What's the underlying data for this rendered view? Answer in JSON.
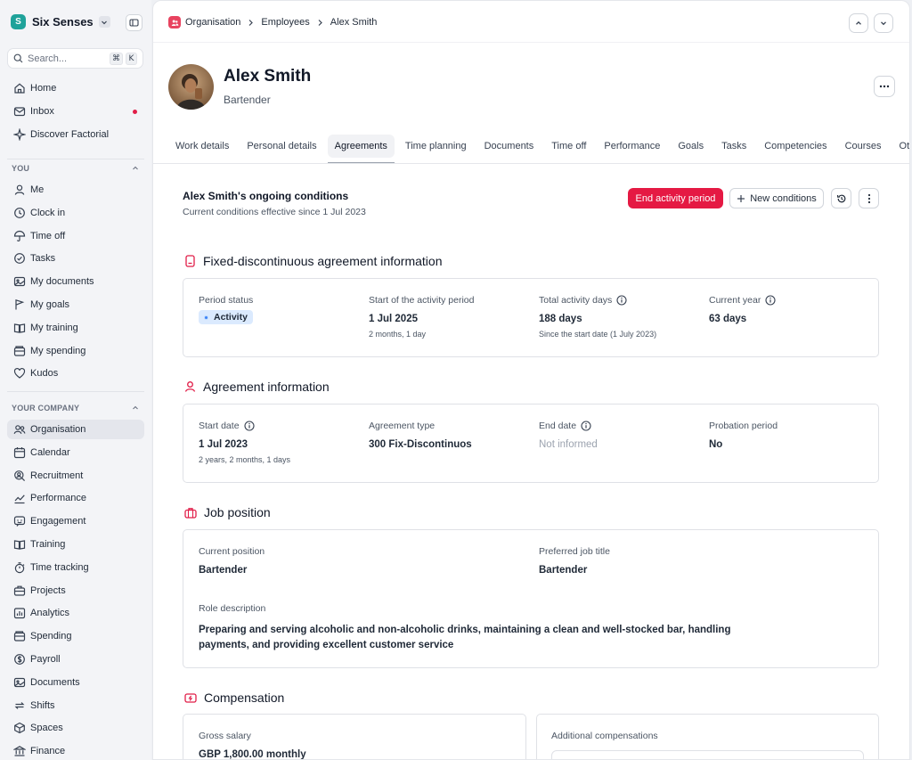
{
  "sidebar": {
    "company": "Six Senses",
    "company_initial": "S",
    "search_placeholder": "Search...",
    "shortcut_keys": [
      "⌘",
      "K"
    ],
    "top_items": [
      {
        "label": "Home",
        "icon": "home-icon"
      },
      {
        "label": "Inbox",
        "icon": "inbox-icon"
      },
      {
        "label": "Discover Factorial",
        "icon": "sparkle-icon"
      }
    ],
    "you_title": "YOU",
    "you_items": [
      {
        "label": "Me",
        "icon": "person-icon"
      },
      {
        "label": "Clock in",
        "icon": "clock-icon"
      },
      {
        "label": "Time off",
        "icon": "umbrella-icon"
      },
      {
        "label": "Tasks",
        "icon": "check-circle-icon"
      },
      {
        "label": "My documents",
        "icon": "folder-icon"
      },
      {
        "label": "My goals",
        "icon": "flag-icon"
      },
      {
        "label": "My training",
        "icon": "book-icon"
      },
      {
        "label": "My spending",
        "icon": "wallet-icon"
      },
      {
        "label": "Kudos",
        "icon": "heart-icon"
      }
    ],
    "company_title": "YOUR COMPANY",
    "company_items": [
      {
        "label": "Organisation",
        "icon": "people-icon"
      },
      {
        "label": "Calendar",
        "icon": "calendar-icon"
      },
      {
        "label": "Recruitment",
        "icon": "recruitment-icon"
      },
      {
        "label": "Performance",
        "icon": "chart-line-icon"
      },
      {
        "label": "Engagement",
        "icon": "engagement-icon"
      },
      {
        "label": "Training",
        "icon": "book-icon"
      },
      {
        "label": "Time tracking",
        "icon": "stopwatch-icon"
      },
      {
        "label": "Projects",
        "icon": "briefcase-icon"
      },
      {
        "label": "Analytics",
        "icon": "analytics-icon"
      },
      {
        "label": "Spending",
        "icon": "wallet-icon"
      },
      {
        "label": "Payroll",
        "icon": "payroll-icon"
      },
      {
        "label": "Documents",
        "icon": "folder-icon"
      },
      {
        "label": "Shifts",
        "icon": "shifts-icon"
      },
      {
        "label": "Spaces",
        "icon": "cube-icon"
      },
      {
        "label": "Finance",
        "icon": "finance-icon"
      }
    ]
  },
  "breadcrumb": [
    "Organisation",
    "Employees",
    "Alex Smith"
  ],
  "employee": {
    "name": "Alex Smith",
    "role": "Bartender"
  },
  "tabs": [
    "Work details",
    "Personal details",
    "Agreements",
    "Time planning",
    "Documents",
    "Time off",
    "Performance",
    "Goals",
    "Tasks",
    "Competencies",
    "Courses",
    "Others"
  ],
  "active_tab": "Agreements",
  "conditions": {
    "title": "Alex Smith's ongoing conditions",
    "subtitle": "Current conditions effective since 1 Jul 2023",
    "end_button": "End activity period",
    "new_button": "New conditions"
  },
  "fixed_section": {
    "title": "Fixed-discontinuous agreement information",
    "period_status_label": "Period status",
    "period_status_value": "Activity",
    "start_label": "Start of the activity period",
    "start_value": "1 Jul 2025",
    "start_note": "2 months, 1 day",
    "total_label": "Total activity days",
    "total_value": "188 days",
    "total_note": "Since the start date (1 July 2023)",
    "year_label": "Current year",
    "year_value": "63 days"
  },
  "agreement_section": {
    "title": "Agreement information",
    "start_label": "Start date",
    "start_value": "1 Jul 2023",
    "start_note": "2 years, 2 months, 1 days",
    "type_label": "Agreement type",
    "type_value": "300 Fix-Discontinuos",
    "end_label": "End date",
    "end_value": "Not informed",
    "probation_label": "Probation period",
    "probation_value": "No"
  },
  "job_section": {
    "title": "Job position",
    "current_label": "Current position",
    "current_value": "Bartender",
    "preferred_label": "Preferred job title",
    "preferred_value": "Bartender",
    "role_label": "Role description",
    "role_value": "Preparing and serving alcoholic and non-alcoholic drinks, maintaining a clean and well-stocked bar, handling payments, and providing excellent customer service"
  },
  "compensation_section": {
    "title": "Compensation",
    "gross_label": "Gross salary",
    "gross_value": "GBP 1,800.00 monthly",
    "additional_label": "Additional compensations"
  },
  "colors": {
    "accent_red": "#e51943",
    "brand_teal": "#1fa29a",
    "badge_blue": "#dbeafe"
  }
}
